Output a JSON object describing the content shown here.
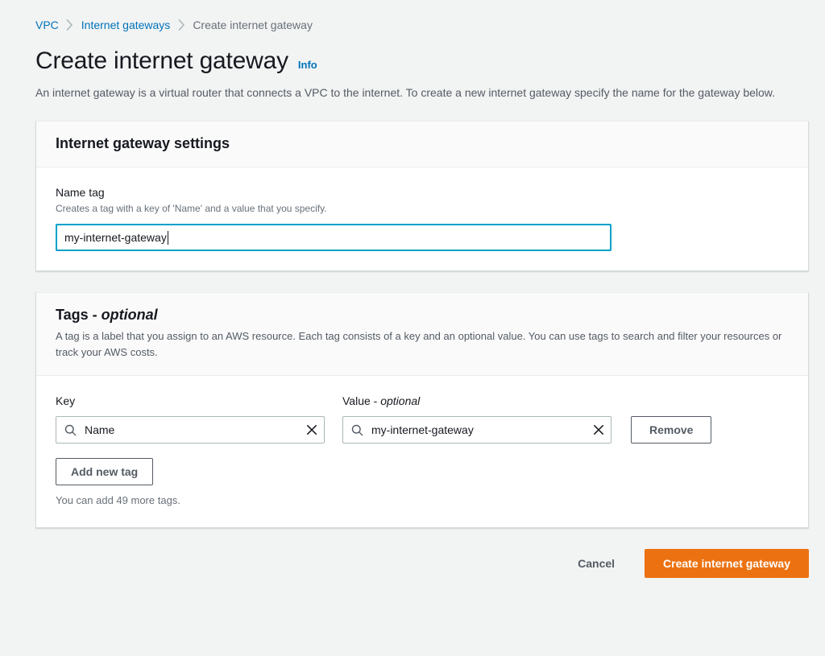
{
  "breadcrumb": {
    "items": [
      {
        "label": "VPC",
        "type": "link"
      },
      {
        "label": "Internet gateways",
        "type": "link"
      },
      {
        "label": "Create internet gateway",
        "type": "current"
      }
    ],
    "separator": "chevron-right"
  },
  "header": {
    "title": "Create internet gateway",
    "info_label": "Info",
    "description": "An internet gateway is a virtual router that connects a VPC to the internet. To create a new internet gateway specify the name for the gateway below."
  },
  "settings_card": {
    "title": "Internet gateway settings",
    "name_tag": {
      "label": "Name tag",
      "description": "Creates a tag with a key of 'Name' and a value that you specify.",
      "value": "my-internet-gateway",
      "placeholder": "",
      "focused": true
    }
  },
  "tags_card": {
    "title_main": "Tags - ",
    "title_optional": "optional",
    "description": "A tag is a label that you assign to an AWS resource. Each tag consists of a key and an optional value. You can use tags to search and filter your resources or track your AWS costs.",
    "columns": {
      "key_label": "Key",
      "value_label_main": "Value - ",
      "value_label_optional": "optional"
    },
    "rows": [
      {
        "key": "Name",
        "key_placeholder": "Key",
        "value": "my-internet-gateway",
        "value_placeholder": "Value",
        "remove_label": "Remove"
      }
    ],
    "add_tag_label": "Add new tag",
    "hint": "You can add 49 more tags."
  },
  "footer": {
    "cancel_label": "Cancel",
    "submit_label": "Create internet gateway"
  },
  "colors": {
    "page_background": "#f2f3f3",
    "link_blue": "#0073bb",
    "focus_blue": "#00a1c9",
    "primary_orange": "#ec7211",
    "text_primary": "#16191f",
    "text_secondary": "#545b64",
    "text_muted": "#687078",
    "border_gray": "#aab7b8",
    "card_border": "#d5dbdb"
  }
}
